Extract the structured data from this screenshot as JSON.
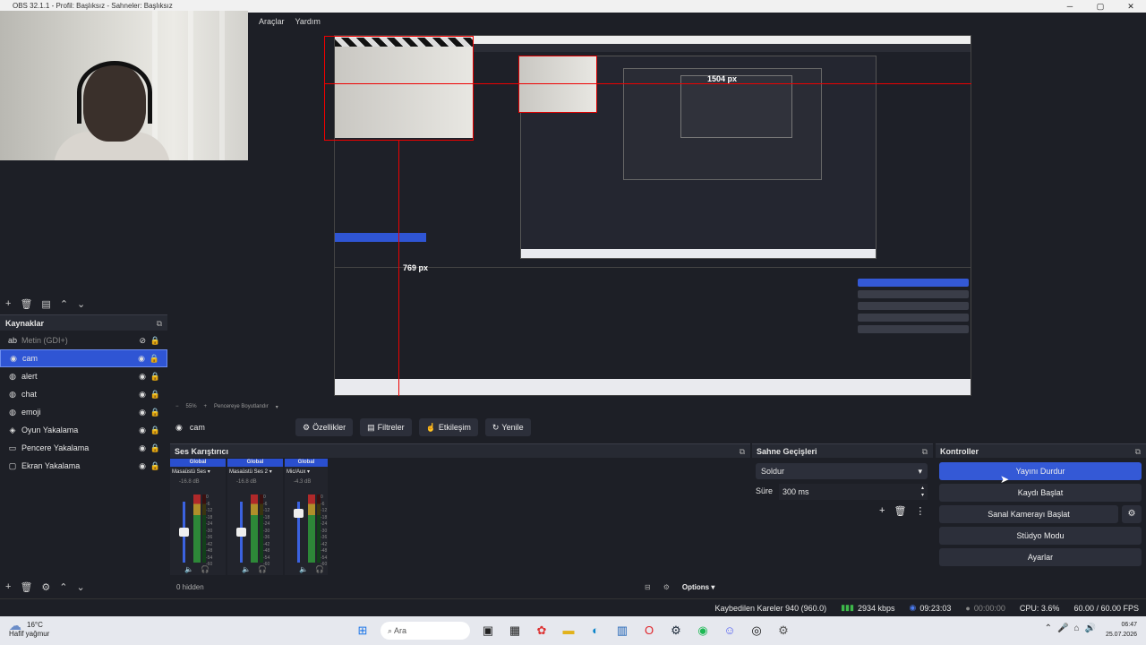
{
  "window": {
    "title": "OBS 32.1.1 - Profil: Başlıksız - Sahneler: Başlıksız"
  },
  "menu": [
    "Araçlar",
    "Yardım"
  ],
  "preview": {
    "width_label": "1504 px",
    "height_label": "769 px",
    "zoom": "55%",
    "fit_label": "Pencereye Boyutlandır"
  },
  "sources": {
    "header": "Kaynaklar",
    "items": [
      {
        "label": "Metin (GDI+)",
        "icon": "text-icon",
        "visible": false
      },
      {
        "label": "cam",
        "icon": "camera-icon",
        "visible": true,
        "selected": true
      },
      {
        "label": "alert",
        "icon": "globe-icon",
        "visible": true
      },
      {
        "label": "chat",
        "icon": "globe-icon",
        "visible": true
      },
      {
        "label": "emoji",
        "icon": "globe-icon",
        "visible": true
      },
      {
        "label": "Oyun Yakalama",
        "icon": "gamepad-icon",
        "visible": true
      },
      {
        "label": "Pencere Yakalama",
        "icon": "window-icon",
        "visible": true
      },
      {
        "label": "Ekran Yakalama",
        "icon": "monitor-icon",
        "visible": true
      }
    ]
  },
  "context": {
    "source": "cam",
    "buttons": [
      "Özellikler",
      "Filtreler",
      "Etkileşim",
      "Yenile"
    ]
  },
  "mixer": {
    "header": "Ses Karıştırıcı",
    "channels": [
      {
        "group": "Global",
        "name": "Masaüstü Ses",
        "db": "-16.8 dB",
        "level": 0.5
      },
      {
        "group": "Global",
        "name": "Masaüstü Ses 2",
        "db": "-16.8 dB",
        "level": 0.5
      },
      {
        "group": "Global",
        "name": "Mic/Aux",
        "db": "-4.3 dB",
        "level": 0.86
      }
    ],
    "scale": [
      "0",
      "-6",
      "-12",
      "-18",
      "-24",
      "-30",
      "-36",
      "-42",
      "-48",
      "-54",
      "-60"
    ],
    "hidden": "0 hidden",
    "options": "Options"
  },
  "transitions": {
    "header": "Sahne Geçişleri",
    "selected": "Soldur",
    "duration_label": "Süre",
    "duration": "300 ms"
  },
  "controls": {
    "header": "Kontroller",
    "buttons": [
      "Yayını Durdur",
      "Kaydı Başlat",
      "Sanal Kamerayı Başlat",
      "Stüdyo Modu",
      "Ayarlar"
    ]
  },
  "status": {
    "dropped": "Kaybedilen Kareler 940 (960.0)",
    "bitrate": "2934 kbps",
    "stream_time": "09:23:03",
    "rec_time": "00:00:00",
    "cpu": "CPU: 3.6%",
    "fps": "60.00 / 60.00 FPS"
  },
  "taskbar": {
    "temp": "16°C",
    "weather": "Hafif yağmur",
    "search": "Ara",
    "time": "06:47",
    "date": "25.07.2026"
  },
  "colors": {
    "accent": "#3459d6",
    "guide": "#e00000",
    "bg": "#1d1f26"
  }
}
